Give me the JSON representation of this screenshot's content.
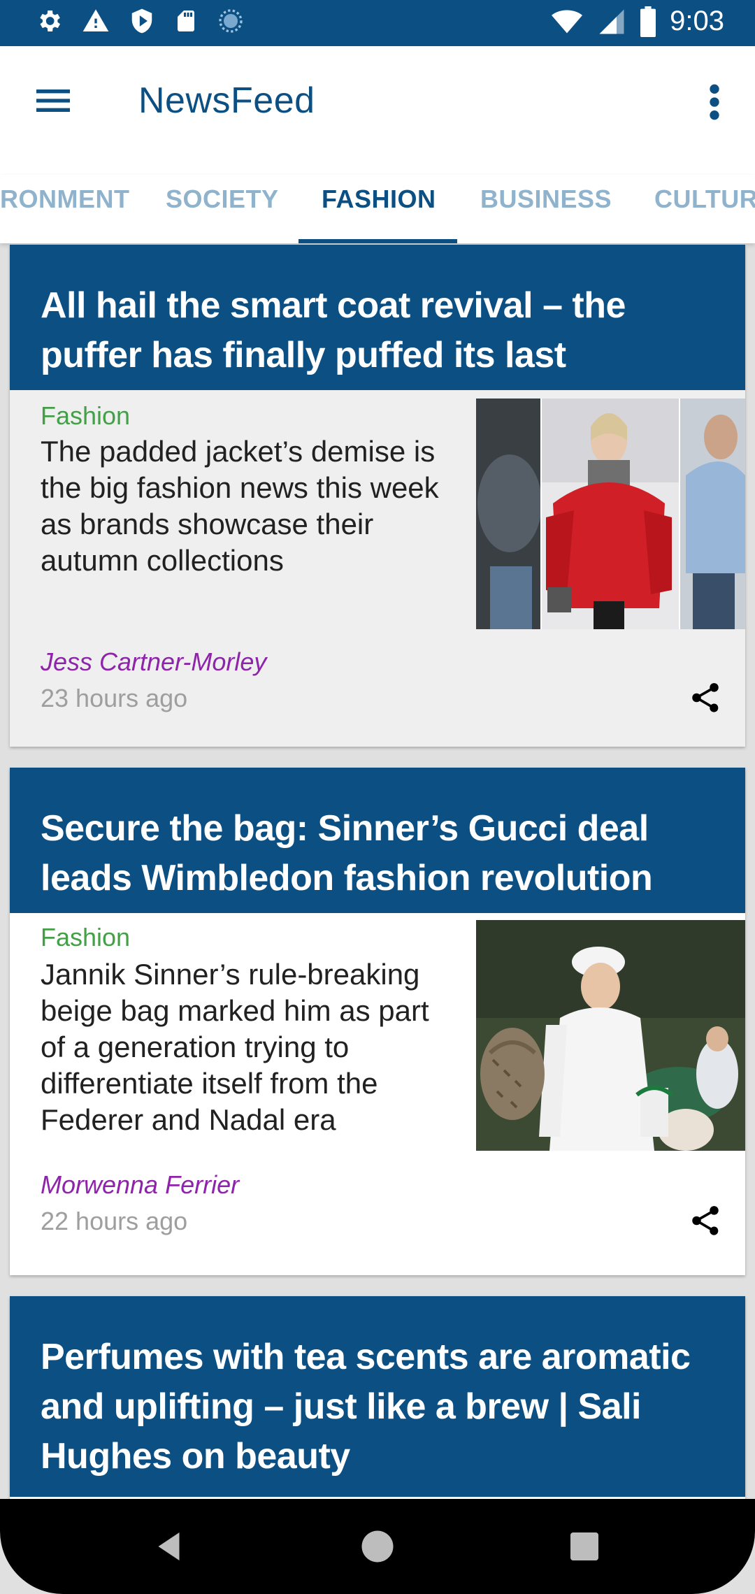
{
  "status_bar": {
    "time": "9:03",
    "left_icons": [
      "settings-icon",
      "warning-icon",
      "shield-icon",
      "sd-card-icon",
      "sync-icon"
    ],
    "right_icons": [
      "wifi-icon",
      "cell-signal-icon",
      "battery-icon"
    ]
  },
  "app_bar": {
    "title": "NewsFeed",
    "menu_icon": "hamburger-menu-icon",
    "more_icon": "more-vert-icon"
  },
  "tabs": [
    {
      "label": "ENVIRONMENT",
      "visible_text": "RONMENT",
      "active": false
    },
    {
      "label": "SOCIETY",
      "visible_text": "SOCIETY",
      "active": false
    },
    {
      "label": "FASHION",
      "visible_text": "FASHION",
      "active": true
    },
    {
      "label": "BUSINESS",
      "visible_text": "BUSINESS",
      "active": false
    },
    {
      "label": "CULTURE",
      "visible_text": "CULTUR",
      "active": false
    }
  ],
  "articles": [
    {
      "title": "All hail the smart coat revival – the puffer has finally puffed its last",
      "category": "Fashion",
      "summary": "The padded jacket’s demise is the big fashion news this week as brands showcase their autumn collections",
      "author": "Jess Cartner-Morley",
      "time_ago": "23 hours ago"
    },
    {
      "title": "Secure the bag: Sinner’s Gucci deal leads Wimbledon fashion revolution",
      "category": "Fashion",
      "summary": "Jannik Sinner’s rule-breaking beige bag marked him as part of a generation trying to differentiate itself from the Federer and Nadal era",
      "author": "Morwenna Ferrier",
      "time_ago": "22 hours ago"
    },
    {
      "title": "Perfumes with tea scents are aromatic and uplifting – just like a brew | Sali Hughes on beauty"
    }
  ],
  "colors": {
    "primary": "#0c4f83",
    "category": "#43a047",
    "author": "#8e24aa",
    "tab_inactive": "#8fb3cc"
  },
  "nav_bar": [
    "back-icon",
    "home-icon",
    "recents-icon"
  ]
}
